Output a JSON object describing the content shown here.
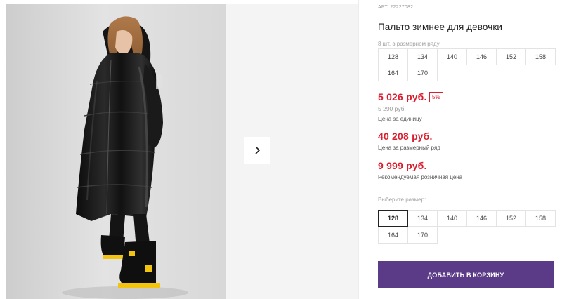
{
  "product": {
    "article": "АРТ. 22227082",
    "title": "Пальто зимнее для девочки",
    "sizes_in_row_caption": "8 шт. в размерном ряду",
    "sizes_in_row": [
      "128",
      "134",
      "140",
      "146",
      "152",
      "158",
      "164",
      "170"
    ],
    "unit_price": "5 026 руб.",
    "discount_badge": "5%",
    "old_price": "5 290 руб.",
    "unit_price_note": "Цена за единицу",
    "row_price": "40 208 руб.",
    "row_price_note": "Цена за размерный ряд",
    "retail_price": "9 999 руб.",
    "retail_price_note": "Рекомендуемая розничная цена",
    "select_size_caption": "Выберите размер:",
    "selectable_sizes": [
      "128",
      "134",
      "140",
      "146",
      "152",
      "158",
      "164",
      "170"
    ],
    "selected_size": "128",
    "add_to_cart_label": "ДОБАВИТЬ В КОРЗИНУ"
  },
  "gallery": {
    "next_icon": "chevron-right-icon"
  },
  "colors": {
    "price_red": "#d81f2f",
    "button_purple": "#5b3b87",
    "coat_black": "#141414",
    "boot_yellow": "#f2c40f"
  }
}
